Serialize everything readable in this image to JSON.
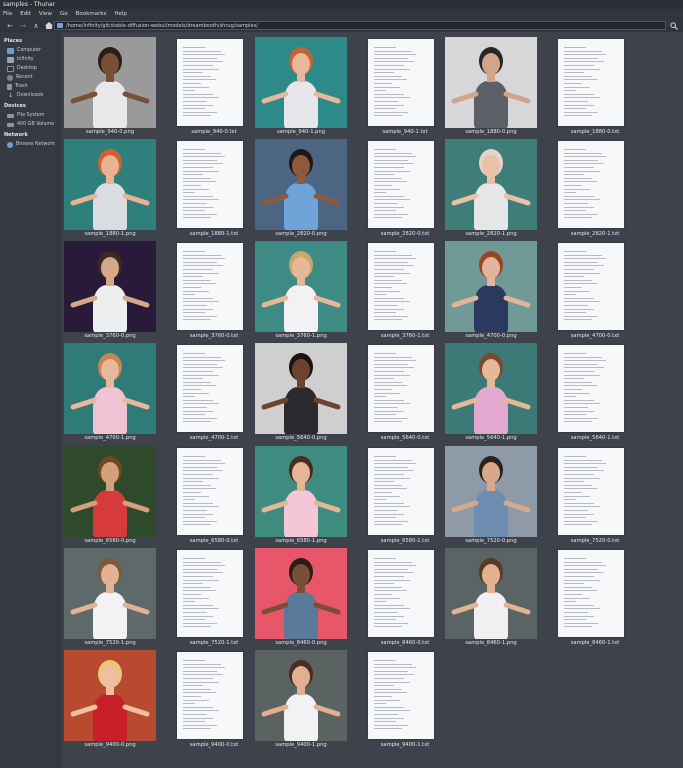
{
  "window": {
    "title": "samples - Thunar"
  },
  "menu": [
    "File",
    "Edit",
    "View",
    "Go",
    "Bookmarks",
    "Help"
  ],
  "path": "/home/infinity/git/stable-diffusion-webui/models/dreambooth/shrug/samples/",
  "sidebar": {
    "places_label": "Places",
    "places": [
      {
        "label": "Computer",
        "icon": "computer-icon"
      },
      {
        "label": "Infinity",
        "icon": "home-icon"
      },
      {
        "label": "Desktop",
        "icon": "desktop-icon"
      },
      {
        "label": "Recent",
        "icon": "recent-icon"
      },
      {
        "label": "Trash",
        "icon": "trash-icon"
      },
      {
        "label": "Downloads",
        "icon": "downloads-icon"
      }
    ],
    "devices_label": "Devices",
    "devices": [
      {
        "label": "File System",
        "icon": "drive-icon"
      },
      {
        "label": "400 GB Volume",
        "icon": "drive-icon"
      }
    ],
    "network_label": "Network",
    "network": [
      {
        "label": "Browse Network",
        "icon": "network-icon"
      }
    ]
  },
  "files": [
    {
      "name": "sample_940-0.png",
      "kind": "image",
      "bg": "#9a9a9a",
      "skin": "#7a4f38",
      "shirt": "#e8e8ea",
      "hair": "#2a1d16"
    },
    {
      "name": "sample_940-0.txt",
      "kind": "text"
    },
    {
      "name": "sample_940-1.png",
      "kind": "image",
      "bg": "#2d8a88",
      "skin": "#e8b89a",
      "shirt": "#e6e6ea",
      "hair": "#c4623a"
    },
    {
      "name": "sample_940-1.txt",
      "kind": "text"
    },
    {
      "name": "sample_1880-0.png",
      "kind": "image",
      "bg": "#d7d7d9",
      "skin": "#d2a48a",
      "shirt": "#5b5f66",
      "hair": "#2a2626"
    },
    {
      "name": "sample_1880-0.txt",
      "kind": "text"
    },
    {
      "name": "sample_1880-1.png",
      "kind": "image",
      "bg": "#2f7f7c",
      "skin": "#e8b393",
      "shirt": "#d9dce0",
      "hair": "#d0612e"
    },
    {
      "name": "sample_1880-1.txt",
      "kind": "text"
    },
    {
      "name": "sample_2820-0.png",
      "kind": "image",
      "bg": "#4b6582",
      "skin": "#8c5a3c",
      "shirt": "#6ea4d8",
      "hair": "#1f1816"
    },
    {
      "name": "sample_2820-0.txt",
      "kind": "text"
    },
    {
      "name": "sample_2820-1.png",
      "kind": "image",
      "bg": "#3f7d78",
      "skin": "#eac0a8",
      "shirt": "#e6e6e8",
      "hair": "#e8d2cc"
    },
    {
      "name": "sample_2820-1.txt",
      "kind": "text"
    },
    {
      "name": "sample_3760-0.png",
      "kind": "image",
      "bg": "#2a1a3a",
      "skin": "#d4a888",
      "shirt": "#eceef0",
      "hair": "#3b2a22"
    },
    {
      "name": "sample_3760-0.txt",
      "kind": "text"
    },
    {
      "name": "sample_3760-1.png",
      "kind": "image",
      "bg": "#3e8a84",
      "skin": "#e6b898",
      "shirt": "#f2f2f4",
      "hair": "#c9a66a"
    },
    {
      "name": "sample_3760-1.txt",
      "kind": "text"
    },
    {
      "name": "sample_4700-0.png",
      "kind": "image",
      "bg": "#6f9a96",
      "skin": "#e2b49c",
      "shirt": "#2a3a5e",
      "hair": "#9a4422"
    },
    {
      "name": "sample_4700-0.txt",
      "kind": "text"
    },
    {
      "name": "sample_4700-1.png",
      "kind": "image",
      "bg": "#2f7b78",
      "skin": "#e8b89a",
      "shirt": "#f0c2d4",
      "hair": "#c8844e"
    },
    {
      "name": "sample_4700-1.txt",
      "kind": "text"
    },
    {
      "name": "sample_5640-0.png",
      "kind": "image",
      "bg": "#cfcfcf",
      "skin": "#6d4330",
      "shirt": "#2a2a2e",
      "hair": "#1a1412"
    },
    {
      "name": "sample_5640-0.txt",
      "kind": "text"
    },
    {
      "name": "sample_5640-1.png",
      "kind": "image",
      "bg": "#3b7a76",
      "skin": "#e6b898",
      "shirt": "#e2a8d0",
      "hair": "#7a4a2c"
    },
    {
      "name": "sample_5640-1.txt",
      "kind": "text"
    },
    {
      "name": "sample_6580-0.png",
      "kind": "image",
      "bg": "#2e4a2a",
      "skin": "#d2a07a",
      "shirt": "#d73a3a",
      "hair": "#6b4a22"
    },
    {
      "name": "sample_6580-0.txt",
      "kind": "text"
    },
    {
      "name": "sample_6580-1.png",
      "kind": "image",
      "bg": "#3e8c80",
      "skin": "#e4b696",
      "shirt": "#f4c6d6",
      "hair": "#4a2c1e"
    },
    {
      "name": "sample_6580-1.txt",
      "kind": "text"
    },
    {
      "name": "sample_7520-0.png",
      "kind": "image",
      "bg": "#8e9aa8",
      "skin": "#d8a88a",
      "shirt": "#6e8cb0",
      "hair": "#2a221e"
    },
    {
      "name": "sample_7520-0.txt",
      "kind": "text"
    },
    {
      "name": "sample_7520-1.png",
      "kind": "image",
      "bg": "#5e6a6a",
      "skin": "#e2b292",
      "shirt": "#f2f2f4",
      "hair": "#7a5a3a"
    },
    {
      "name": "sample_7520-1.txt",
      "kind": "text"
    },
    {
      "name": "sample_8460-0.png",
      "kind": "image",
      "bg": "#e8566a",
      "skin": "#7a4e36",
      "shirt": "#5a7a9a",
      "hair": "#2a1c16"
    },
    {
      "name": "sample_8460-0.txt",
      "kind": "text"
    },
    {
      "name": "sample_8460-1.png",
      "kind": "image",
      "bg": "#5a6464",
      "skin": "#e2b292",
      "shirt": "#f0f0f2",
      "hair": "#5a3a26"
    },
    {
      "name": "sample_8460-1.txt",
      "kind": "text"
    },
    {
      "name": "sample_9400-0.png",
      "kind": "image",
      "bg": "#b84a30",
      "skin": "#eec0a0",
      "shirt": "#c81e2a",
      "hair": "#e8c878"
    },
    {
      "name": "sample_9400-0.txt",
      "kind": "text"
    },
    {
      "name": "sample_9400-1.png",
      "kind": "image",
      "bg": "#5a6262",
      "skin": "#e0b090",
      "shirt": "#f2f2f4",
      "hair": "#4a2e20"
    },
    {
      "name": "sample_9400-1.txt",
      "kind": "text"
    }
  ]
}
